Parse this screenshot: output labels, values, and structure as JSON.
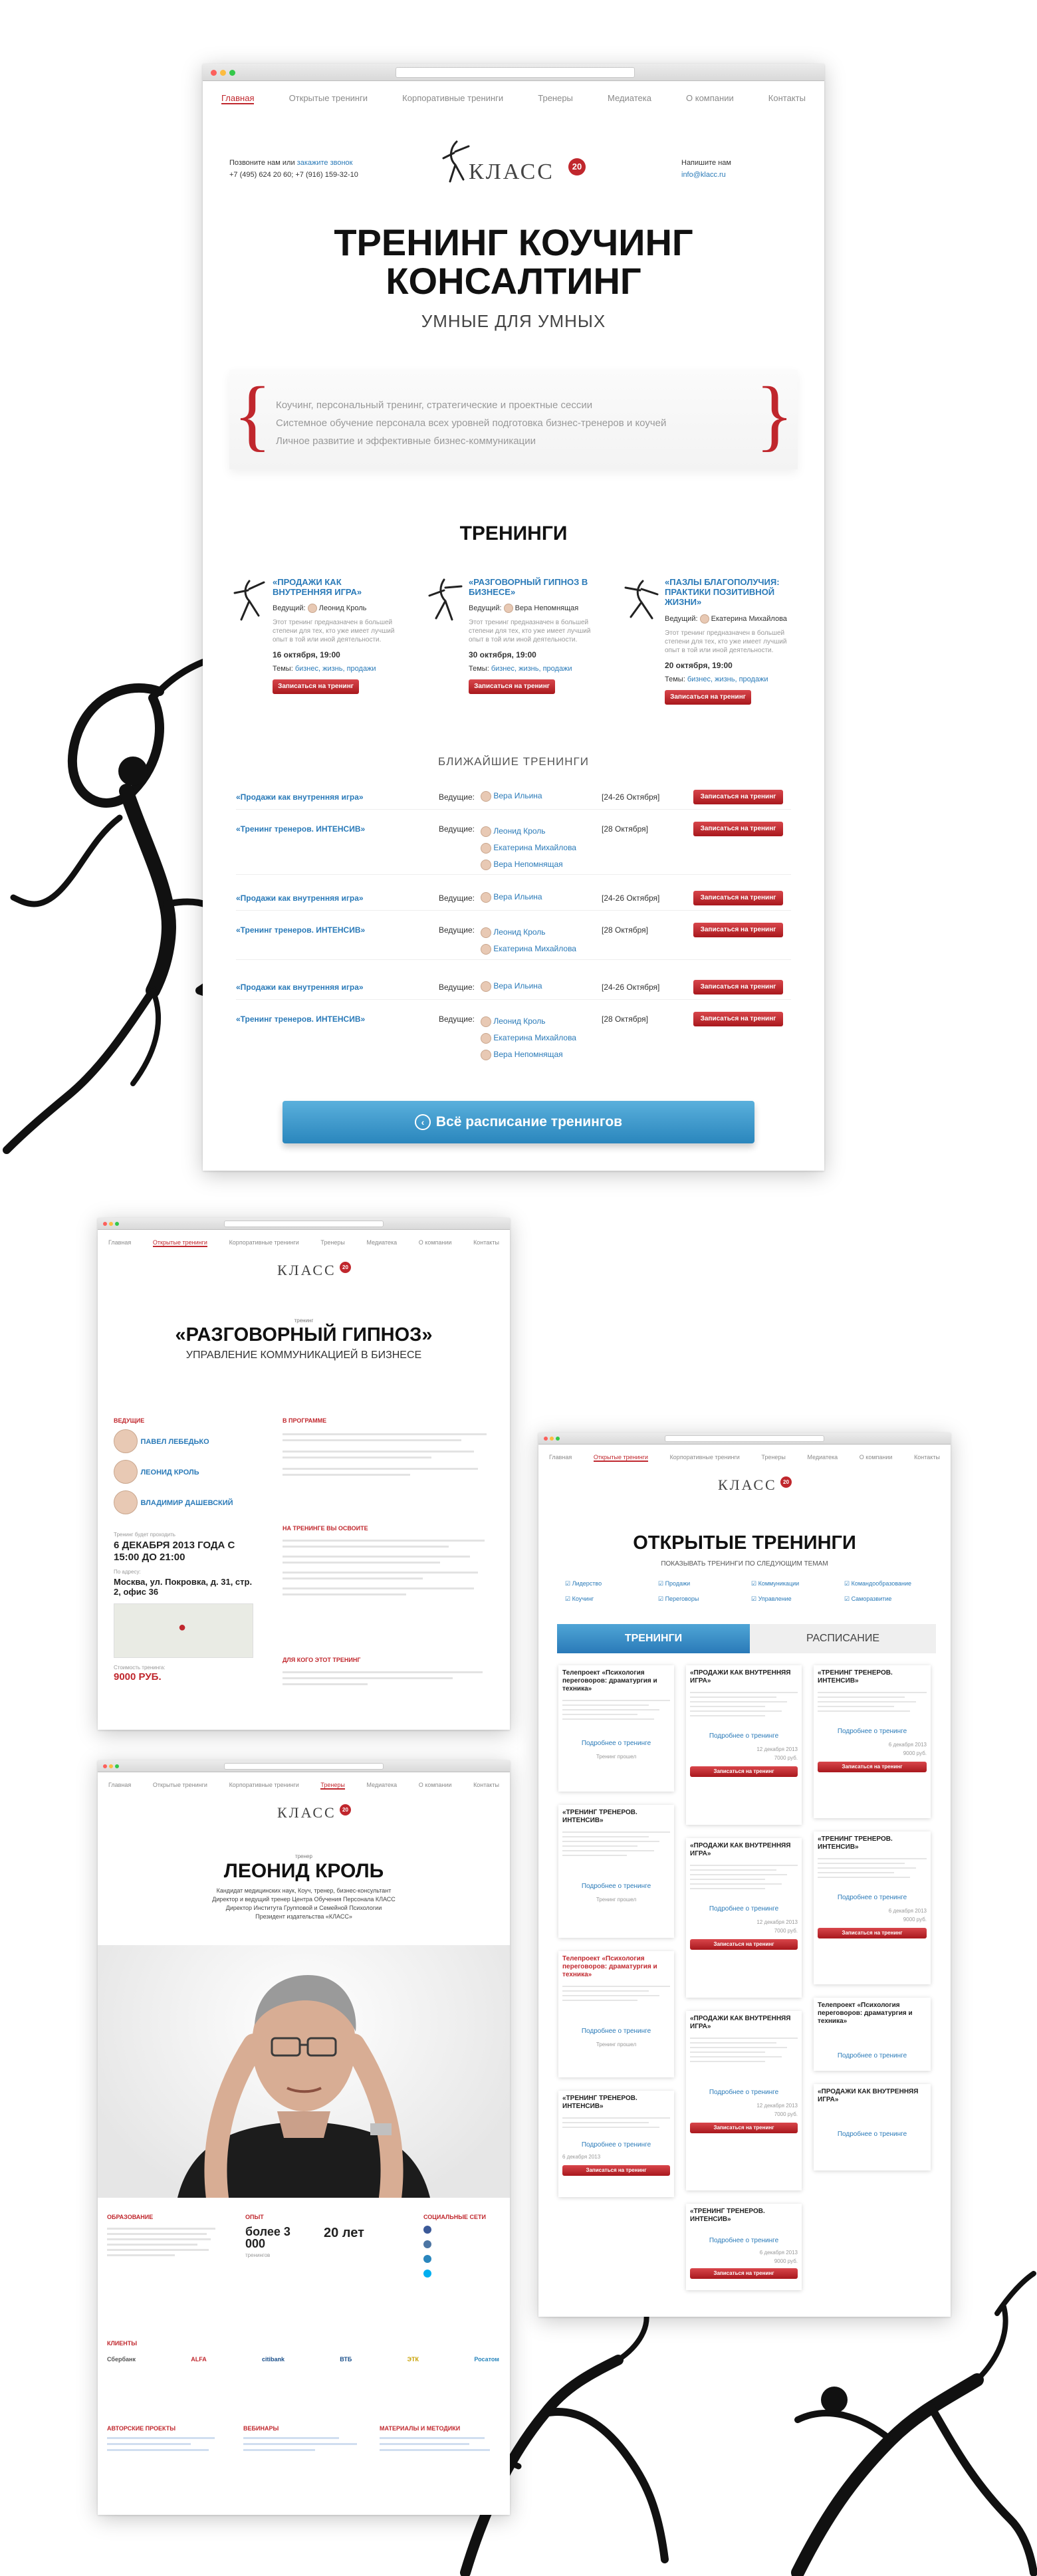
{
  "main": {
    "nav": [
      "Главная",
      "Открытые тренинги",
      "Корпоративные тренинги",
      "Тренеры",
      "Медиатека",
      "О компании",
      "Контакты"
    ],
    "call_us": "Позвоните нам или",
    "order_call": "закажите звонок",
    "phones": "+7 (495) 624 20 60; +7 (916) 159-32-10",
    "logo": "КЛАСС",
    "logo_badge": "20",
    "write_us": "Напишите нам",
    "email": "info@klacc.ru",
    "hero_line1": "ТРЕНИНГ КОУЧИНГ",
    "hero_line2": "КОНСАЛТИНГ",
    "hero_sub": "УМНЫЕ ДЛЯ УМНЫХ",
    "bullets": [
      "Коучинг, персональный тренинг, стратегические и проектные сессии",
      "Системное обучение персонала всех уровней подготовка бизнес-тренеров и коучей",
      "Личное развитие и эффективные бизнес-коммуникации"
    ],
    "trainings_title": "ТРЕНИНГИ",
    "cards": [
      {
        "title": "«ПРОДАЖИ КАК ВНУТРЕННЯЯ ИГРА»",
        "host_label": "Ведущий:",
        "host": "Леонид Кроль",
        "desc": "Этот тренинг предназначен в большей степени для тех, кто уже имеет лучший опыт в той или иной деятельности.",
        "date": "16 октября, 19:00",
        "topics_label": "Темы:",
        "topics": "бизнес, жизнь, продажи",
        "btn": "Записаться на тренинг"
      },
      {
        "title": "«РАЗГОВОРНЫЙ ГИПНОЗ В БИЗНЕСЕ»",
        "host_label": "Ведущий:",
        "host": "Вера Непомнящая",
        "desc": "Этот тренинг предназначен в большей степени для тех, кто уже имеет лучший опыт в той или иной деятельности.",
        "date": "30 октября, 19:00",
        "topics_label": "Темы:",
        "topics": "бизнес, жизнь, продажи",
        "btn": "Записаться на тренинг"
      },
      {
        "title": "«ПАЗЛЫ БЛАГОПОЛУЧИЯ: ПРАКТИКИ ПОЗИТИВНОЙ ЖИЗНИ»",
        "host_label": "Ведущий:",
        "host": "Екатерина Михайлова",
        "desc": "Этот тренинг предназначен в большей степени для тех, кто уже имеет лучший опыт в той или иной деятельности.",
        "date": "20 октября, 19:00",
        "topics_label": "Темы:",
        "topics": "бизнес, жизнь, продажи",
        "btn": "Записаться на тренинг"
      }
    ],
    "nearest_title": "БЛИЖАЙШИЕ ТРЕНИНГИ",
    "nearest": [
      {
        "name": "«Продажи как внутренняя игра»",
        "hosts": [
          "Вера Ильина"
        ],
        "date": "[24-26 Октября]"
      },
      {
        "name": "«Тренинг тренеров. ИНТЕНСИВ»",
        "hosts": [
          "Леонид Кроль",
          "Екатерина Михайлова",
          "Вера Непомнящая"
        ],
        "date": "[28 Октября]"
      },
      {
        "name": "«Продажи как внутренняя игра»",
        "hosts": [
          "Вера Ильина"
        ],
        "date": "[24-26 Октября]"
      },
      {
        "name": "«Тренинг тренеров. ИНТЕНСИВ»",
        "hosts": [
          "Леонид Кроль",
          "Екатерина Михайлова"
        ],
        "date": "[28 Октября]"
      },
      {
        "name": "«Продажи как внутренняя игра»",
        "hosts": [
          "Вера Ильина"
        ],
        "date": "[24-26 Октября]"
      },
      {
        "name": "«Тренинг тренеров. ИНТЕНСИВ»",
        "hosts": [
          "Леонид Кроль",
          "Екатерина Михайлова",
          "Вера Непомнящая"
        ],
        "date": "[28 Октября]"
      }
    ],
    "host_label": "Ведущие:",
    "nearest_btn": "Записаться на тренинг",
    "schedule_btn": "Всё расписание тренингов"
  },
  "hypno": {
    "label": "тренинг",
    "title": "«РАЗГОВОРНЫЙ ГИПНОЗ»",
    "subtitle": "УПРАВЛЕНИЕ КОММУНИКАЦИЕЙ В БИЗНЕСЕ",
    "hosts_title": "ВЕДУЩИЕ",
    "hosts": [
      {
        "name": "ПАВЕЛ ЛЕБЕДЬКО"
      },
      {
        "name": "ЛЕОНИД КРОЛЬ"
      },
      {
        "name": "ВЛАДИМИР ДАШЕВСКИЙ"
      }
    ],
    "when_label": "Тренинг будет проходить",
    "when": "6 ДЕКАБРЯ 2013 ГОДА С 15:00 ДО 21:00",
    "where_label": "По адресу:",
    "where": "Москва, ул. Покровка, д. 31, стр. 2, офис 36",
    "price_label": "Стоимость тренинга:",
    "price": "9000 РУБ.",
    "program_title": "В ПРОГРАММЕ",
    "learn_title": "НА ТРЕНИНГЕ ВЫ ОСВОИТЕ",
    "for_title": "ДЛЯ КОГО ЭТОТ ТРЕНИНГ"
  },
  "krol": {
    "label": "тренер",
    "name": "ЛЕОНИД КРОЛЬ",
    "bio": [
      "Кандидат медицинских наук, Коуч, тренер, бизнес-консультант",
      "Директор и ведущий тренер Центра Обучения Персонала КЛАСС",
      "Директор Института Групповой и Семейной Психологии",
      "Президент издательства «КЛАСС»"
    ],
    "edu_title": "ОБРАЗОВАНИЕ",
    "exp_title": "ОПЫТ",
    "exp_num1": "более 3 000",
    "exp_num2": "20 лет",
    "exp_cap": "тренингов",
    "social_title": "СОЦИАЛЬНЫЕ СЕТИ",
    "clients_title": "КЛИЕНТЫ",
    "clients": [
      "Сбербанк",
      "ALFA",
      "citibank",
      "ВТБ",
      "ЭТК",
      "Росатом"
    ],
    "footer_titles": [
      "АВТОРСКИЕ ПРОЕКТЫ",
      "ВЕБИНАРЫ",
      "МАТЕРИАЛЫ И МЕТОДИКИ"
    ]
  },
  "open": {
    "title": "ОТКРЫТЫЕ ТРЕНИНГИ",
    "subtitle": "ПОКАЗЫВАТЬ ТРЕНИНГИ ПО СЛЕДУЮЩИМ ТЕМАМ",
    "filters": [
      "Лидерство",
      "Продажи",
      "Коммуникации",
      "Командообразование",
      "Коучинг",
      "Переговоры",
      "Управление",
      "Саморазвитие"
    ],
    "tab_active": "ТРЕНИНГИ",
    "tab_other": "РАСПИСАНИЕ",
    "cards": [
      {
        "title": "Телепроект «Психология переговоров: драматургия и техника»",
        "more": "Подробнее о тренинге",
        "note": "Тренинг прошел"
      },
      {
        "title": "«ПРОДАЖИ КАК ВНУТРЕННЯЯ ИГРА»",
        "date": "12 декабря 2013",
        "price": "7000 руб.",
        "more": "Подробнее о тренинге",
        "btn": "Записаться на тренинг"
      },
      {
        "title": "«ТРЕНИНГ ТРЕНЕРОВ. ИНТЕНСИВ»",
        "date": "6 декабря 2013",
        "price": "9000 руб.",
        "more": "Подробнее о тренинге",
        "btn": "Записаться на тренинг"
      },
      {
        "title": "«ТРЕНИНГ ТРЕНЕРОВ. ИНТЕНСИВ»",
        "more": "Подробнее о тренинге",
        "note": "Тренинг прошел"
      },
      {
        "title": "«ПРОДАЖИ КАК ВНУТРЕННЯЯ ИГРА»",
        "date": "12 декабря 2013",
        "price": "7000 руб.",
        "more": "Подробнее о тренинге",
        "btn": "Записаться на тренинг"
      },
      {
        "title": "«ТРЕНИНГ ТРЕНЕРОВ. ИНТЕНСИВ»",
        "date": "6 декабря 2013",
        "price": "9000 руб.",
        "more": "Подробнее о тренинге",
        "btn": "Записаться на тренинг"
      },
      {
        "title": "Телепроект «Психология переговоров: драматургия и техника»",
        "more": "Подробнее о тренинге",
        "note": "Тренинг прошел"
      },
      {
        "title": "«ПРОДАЖИ КАК ВНУТРЕННЯЯ ИГРА»",
        "date": "12 декабря 2013",
        "price": "7000 руб.",
        "more": "Подробнее о тренинге",
        "btn": "Записаться на тренинг"
      },
      {
        "title": "Телепроект «Психология переговоров: драматургия и техника»",
        "more": "Подробнее о тренинге"
      },
      {
        "title": "«ТРЕНИНГ ТРЕНЕРОВ. ИНТЕНСИВ»",
        "date": "6 декабря 2013",
        "price": "9000 руб.",
        "more": "Подробнее о тренинге",
        "btn": "Записаться на тренинг"
      },
      {
        "title": "«ТРЕНИНГ ТРЕНЕРОВ. ИНТЕНСИВ»",
        "date": "6 декабря 2013",
        "price": "9000 руб.",
        "more": "Подробнее о тренинге",
        "btn": "Записаться на тренинг"
      },
      {
        "title": "«ПРОДАЖИ КАК ВНУТРЕННЯЯ ИГРА»",
        "more": "Подробнее о тренинге"
      }
    ]
  }
}
